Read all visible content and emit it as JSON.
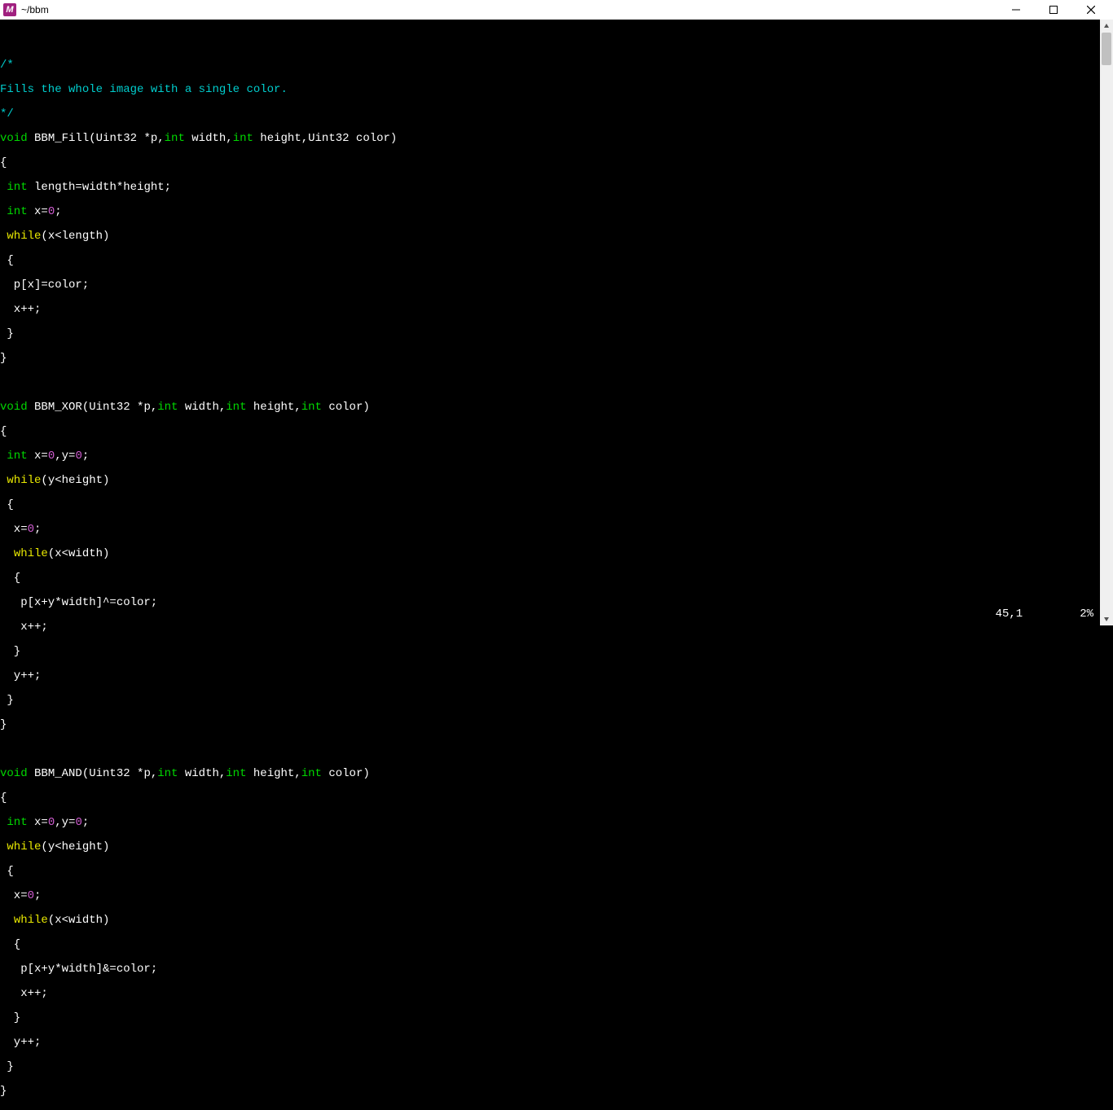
{
  "titlebar": {
    "app_icon_letter": "M",
    "path": "~/bbm"
  },
  "code": {
    "comment_open": "/*",
    "comment_text": "Fills the whole image with a single color.",
    "comment_close": "*/",
    "kw_void": "void",
    "kw_int": "int",
    "kw_while": "while",
    "num_0": "0",
    "fn1": {
      "name": "BBM_Fill",
      "sig_a": "(Uint32 *p,",
      "sig_b": " width,",
      "sig_c": " height,Uint32 color)",
      "l1a": " length=width*height;",
      "l2a": " x=",
      "l2b": ";",
      "l3": "(x<length)",
      "l4": "  p[x]=color;",
      "l5": "  x++;"
    },
    "fn2": {
      "name": "BBM_XOR",
      "sig_a": "(Uint32 *p,",
      "sig_b": " width,",
      "sig_c": " height,",
      "sig_d": " color)",
      "l1a": " x=",
      "l1b": ",y=",
      "l1c": ";",
      "l2": "(y<height)",
      "l3a": "  x=",
      "l3b": ";",
      "l4": "(x<width)",
      "l5": "   p[x+y*width]^=color;",
      "l6": "   x++;",
      "l7": "  y++;"
    },
    "fn3": {
      "name": "BBM_AND",
      "sig_a": "(Uint32 *p,",
      "sig_b": " width,",
      "sig_c": " height,",
      "sig_d": " color)",
      "l1a": " x=",
      "l1b": ",y=",
      "l1c": ";",
      "l2": "(y<height)",
      "l3a": "  x=",
      "l3b": ";",
      "l4": "(x<width)",
      "l5": "   p[x+y*width]&=color;",
      "l6": "   x++;",
      "l7": "  y++;"
    },
    "brace_open": "{",
    "brace_close": "}",
    "brace_open_sp": " {",
    "brace_close_sp": " }",
    "brace_open_sp2": "  {",
    "brace_close_sp2": "  }"
  },
  "status": {
    "pos": "45,1",
    "pct": "2%"
  }
}
